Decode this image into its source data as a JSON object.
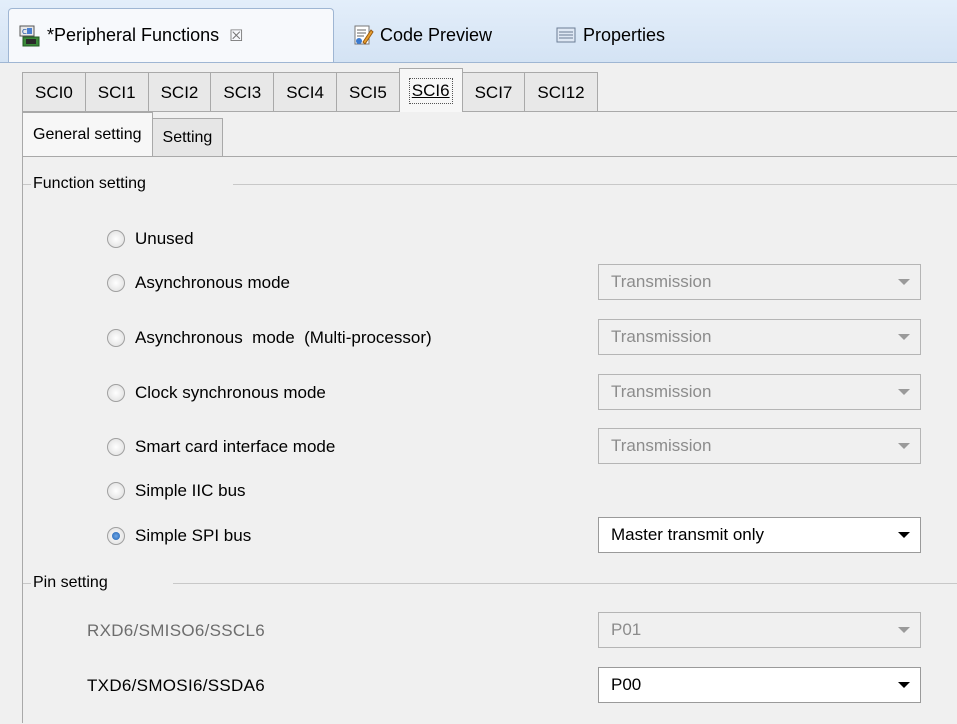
{
  "view_tabs": [
    {
      "label": "*Peripheral Functions",
      "icon": "peripheral-chip-icon",
      "closable": true,
      "active": true
    },
    {
      "label": "Code Preview",
      "icon": "code-preview-icon"
    },
    {
      "label": "Properties",
      "icon": "properties-icon"
    }
  ],
  "close_glyph": "☒",
  "sci_tabs": [
    "SCI0",
    "SCI1",
    "SCI2",
    "SCI3",
    "SCI4",
    "SCI5",
    "SCI6",
    "SCI7",
    "SCI12"
  ],
  "active_sci_tab": "SCI6",
  "sub_tabs": [
    "General setting",
    "Setting"
  ],
  "active_sub_tab": "General setting",
  "function_setting": {
    "label": "Function setting",
    "options": [
      {
        "label": "Unused",
        "checked": false,
        "combo": null
      },
      {
        "label": "Asynchronous mode",
        "checked": false,
        "combo": {
          "value": "Transmission",
          "enabled": false
        }
      },
      {
        "label": "Asynchronous  mode  (Multi-processor)",
        "checked": false,
        "combo": {
          "value": "Transmission",
          "enabled": false
        }
      },
      {
        "label": "Clock synchronous mode",
        "checked": false,
        "combo": {
          "value": "Transmission",
          "enabled": false
        }
      },
      {
        "label": "Smart card interface mode",
        "checked": false,
        "combo": {
          "value": "Transmission",
          "enabled": false
        }
      },
      {
        "label": "Simple IIC bus",
        "checked": false,
        "combo": null
      },
      {
        "label": "Simple SPI bus",
        "checked": true,
        "combo": {
          "value": "Master transmit only",
          "enabled": true
        }
      }
    ]
  },
  "pin_setting": {
    "label": "Pin setting",
    "pins": [
      {
        "label": "RXD6/SMISO6/SSCL6",
        "value": "P01",
        "enabled": false
      },
      {
        "label": "TXD6/SMOSI6/SSDA6",
        "value": "P00",
        "enabled": true
      }
    ]
  },
  "colors": {
    "accent": "#1c5fb2",
    "view_bar": "#d4e3f4",
    "disabled_text": "#8c8c8c"
  }
}
